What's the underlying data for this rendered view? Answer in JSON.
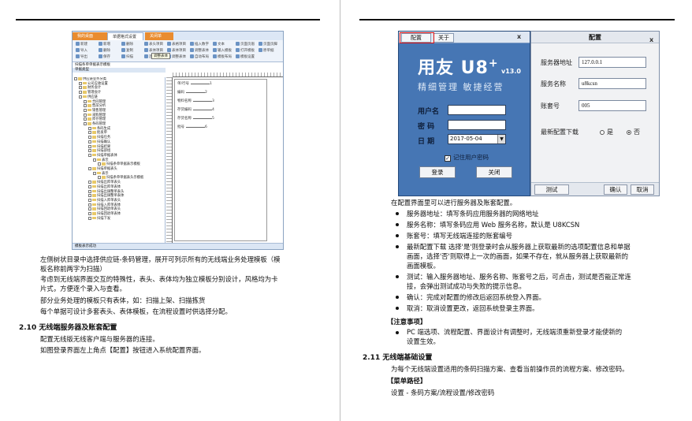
{
  "left_page": {
    "screenshot": {
      "tabs": [
        "我的桌面",
        "单据格式设置",
        "关闭单"
      ],
      "ribbon": {
        "row1": [
          "新建",
          "新增",
          "删除",
          "表头项目",
          "表格项目",
          "插入数字",
          "文本",
          "页面页眉",
          "页面页脚"
        ],
        "row2": [
          "导入",
          "删除",
          "复制",
          "表体项目",
          "表体项目",
          "调整表体",
          "输入模板",
          "打开模板",
          "原单据"
        ],
        "row3": [
          "导出",
          "保存",
          "扫描",
          "连续字体",
          "调整表体",
          "自动布局",
          "模板布局",
          "模板设置"
        ],
        "tooltip": "调整表体"
      },
      "doc_title": "扫描条单单据表示模板",
      "tree_header": "单据类型",
      "tree_nodes": [
        {
          "indent": 0,
          "label": "供应链业务分类"
        },
        {
          "indent": 1,
          "label": "公司应收设置"
        },
        {
          "indent": 1,
          "label": "财务会计"
        },
        {
          "indent": 1,
          "label": "管理会计"
        },
        {
          "indent": 1,
          "label": "供应链"
        },
        {
          "indent": 2,
          "label": "合同管理"
        },
        {
          "indent": 2,
          "label": "售前分析"
        },
        {
          "indent": 2,
          "label": "销售管理"
        },
        {
          "indent": 2,
          "label": "采购管理"
        },
        {
          "indent": 2,
          "label": "库存管理"
        },
        {
          "indent": 2,
          "label": "条码管理"
        },
        {
          "indent": 3,
          "label": "条码生成"
        },
        {
          "indent": 3,
          "label": "批发单"
        },
        {
          "indent": 3,
          "label": "扫描任务"
        },
        {
          "indent": 3,
          "label": "扫描确认"
        },
        {
          "indent": 3,
          "label": "扫描结果"
        },
        {
          "indent": 3,
          "label": "扫描部组"
        },
        {
          "indent": 3,
          "label": "扫描单据表体"
        },
        {
          "indent": 4,
          "label": "表示"
        },
        {
          "indent": 5,
          "label": "扫描条单单据表示模板"
        },
        {
          "indent": 3,
          "label": "扫描单据表头"
        },
        {
          "indent": 4,
          "label": "表示"
        },
        {
          "indent": 5,
          "label": "扫描条单单据表头示模板"
        },
        {
          "indent": 3,
          "label": "扫描出库单表头"
        },
        {
          "indent": 3,
          "label": "扫描出库单表体"
        },
        {
          "indent": 3,
          "label": "扫描出调整单表头"
        },
        {
          "indent": 3,
          "label": "扫描出调整单表体"
        },
        {
          "indent": 3,
          "label": "扫描入库单表头"
        },
        {
          "indent": 3,
          "label": "扫描入库单表体"
        },
        {
          "indent": 3,
          "label": "扫描回退单表头"
        },
        {
          "indent": 3,
          "label": "扫描回退单表体"
        },
        {
          "indent": 3,
          "label": "扫描下发"
        }
      ],
      "design_fields": [
        {
          "name": "单/行号",
          "num": "1"
        },
        {
          "name": "编码",
          "num": "2"
        },
        {
          "name": "物料名称",
          "num": "3"
        },
        {
          "name": "存货编码",
          "num": "4"
        },
        {
          "name": "存货名称",
          "num": "5"
        },
        {
          "name": "批号",
          "num": "6"
        }
      ],
      "status": "模板表示成功"
    },
    "paragraphs": [
      "左侧树状目录中选择供应链-条码管理，展开可列示所有的无线端业务处理模板（模",
      "板名称前两字为扫描）",
      "考虑到无线端界面交互的特殊性，表头、表体均为独立模板分别设计，风格均为卡",
      "片式，方便逐个录入与查看。",
      "部分业务处理的模板只有表体，如：扫描上架、扫描拣货",
      "每个单据可设计多套表头、表体模板，在流程设置时供选择分配。"
    ],
    "section": {
      "number": "2.10",
      "title": "无线端服务器及账套配置"
    },
    "section_paragraphs": [
      "配置无线版无线客户端与服务器的连接。",
      "如图登录界面左上角点【配置】按钮进入系统配置界面。"
    ]
  },
  "right_page": {
    "login": {
      "tab_config": "配置",
      "tab_about": "关于",
      "close": "x",
      "brand": "用友 U8",
      "brand_plus": "+",
      "version": "v13.0",
      "slogan": "精细管理  敏捷经营",
      "user_label": "用户名",
      "password_label": "密  码",
      "date_label": "日  期",
      "date_value": "2017-05-04",
      "remember_label": "记住用户密码",
      "remember_checked": "✓",
      "login_button": "登录",
      "close_button": "关闭"
    },
    "config": {
      "title": "配置",
      "close": "x",
      "server_label": "服务器地址",
      "server_value": "127.0.0.1",
      "service_label": "服务名称",
      "service_value": "u8kcsn",
      "account_label": "账套号",
      "account_value": "005",
      "download_label": "最新配置下载",
      "yes_label": "是",
      "no_label": "否",
      "download_selected": "否",
      "test_button": "测试",
      "ok_button": "确认",
      "cancel_button": "取消"
    },
    "intro": "在配置界面里可以进行服务器及账套配置。",
    "bullets": [
      [
        "服务器地址：填写条码应用服务器的网络地址"
      ],
      [
        "服务名称：填写条码应用 Web 服务名称，默认是 U8KCSN"
      ],
      [
        "账套号：填写无线端连接的账套编号"
      ],
      [
        "最新配置下载 选择'是'则登录时会从服务器上获取最新的选项配置信息和单据",
        "画面，选择'否'则取得上一次的画面，如果不存在，就从服务器上获取最新的",
        "画面模板。"
      ],
      [
        "测试：输入服务器地址、服务名称、账套号之后，可点击，测试是否能正常连",
        "接，会弹出测试成功与失败的提示信息。"
      ],
      [
        "确认：完成对配置的修改后返回系统登入界面。"
      ],
      [
        "取消：取消设置更改，返回系统登录主界面。"
      ]
    ],
    "note_tag": "【注意事项】",
    "note_lines": [
      "PC 端选项、流程配置、界面设计有调整时，无线端须重新登录才能使新的",
      "设置生效。"
    ],
    "section": {
      "number": "2.11",
      "title": "无线端基础设置"
    },
    "section_line": "为每个无线端设置适用的条码扫描方案、查看当前操作员的流程方案、修改密码。",
    "menu_tag": "【菜单路径】",
    "menu_path": "设置 - 条码方案/流程设置/修改密码"
  }
}
